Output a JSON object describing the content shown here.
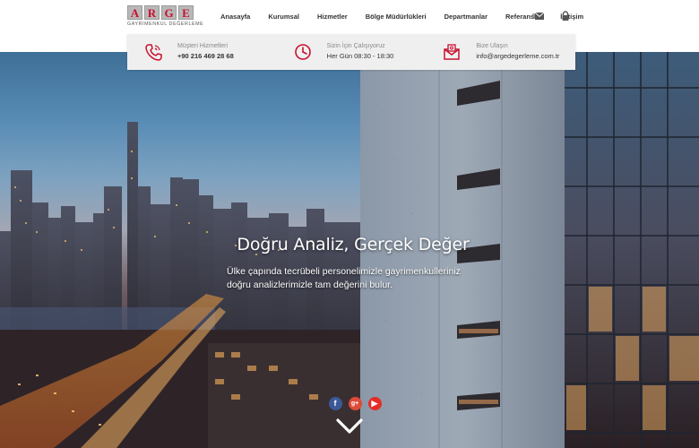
{
  "logo": {
    "letters": [
      "A",
      "R",
      "G",
      "E"
    ],
    "tagline": "GAYRİMENKUL DEĞERLEME"
  },
  "nav": {
    "items": [
      "Anasayfa",
      "Kurumsal",
      "Hizmetler",
      "Bölge Müdürlükleri",
      "Departmanlar",
      "Referanslar",
      "İletişim"
    ],
    "icons": [
      "mail-icon",
      "lock-icon"
    ]
  },
  "contact": {
    "phone": {
      "label": "Müşteri Hizmetleri",
      "value": "+90 216 469 28 68"
    },
    "hours": {
      "label": "Sizin İçin Çalışıyoruz",
      "value": "Her Gün 08:30 - 18:30"
    },
    "email": {
      "label": "Bize Ulaşın",
      "value": "info@argedegerleme.com.tr"
    }
  },
  "hero": {
    "title": "Doğru Analiz, Gerçek Değer",
    "subtitle": "Ülke çapında tecrübeli personelimizle gayrimenkulleriniz doğru analizlerimizle tam değerini bulur."
  },
  "social": {
    "facebook": "f",
    "googleplus": "g+",
    "youtube": "▶"
  },
  "colors": {
    "accent": "#c8102e",
    "contact_bar": "#f0efef",
    "facebook": "#3b5998",
    "googleplus": "#dd4b39",
    "youtube": "#e52d27"
  }
}
